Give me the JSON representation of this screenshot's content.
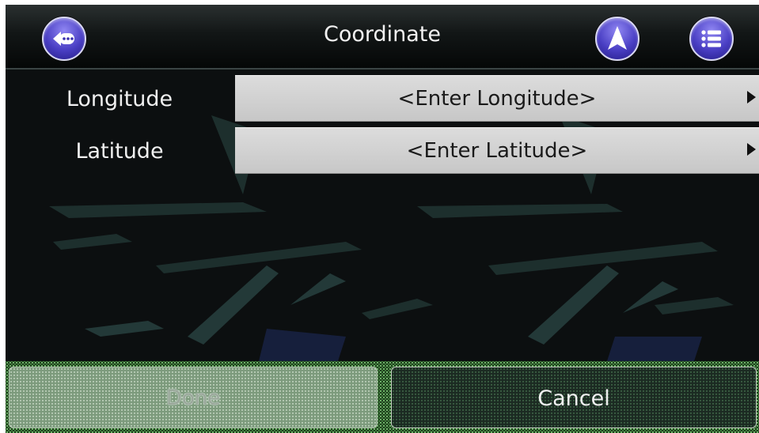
{
  "header": {
    "title": "Coordinate",
    "back_icon": "back-more-icon",
    "navigate_icon": "navigation-arrow-icon",
    "menu_icon": "list-menu-icon"
  },
  "fields": [
    {
      "label": "Longitude",
      "placeholder": "<Enter Longitude>"
    },
    {
      "label": "Latitude",
      "placeholder": "<Enter Latitude>"
    }
  ],
  "buttons": {
    "done_label": "Done",
    "cancel_label": "Cancel"
  },
  "colors": {
    "accent_button": "#4a3fc4",
    "field_bg": "#d4d4d4",
    "bottom_bar": "#2f5a2d"
  }
}
